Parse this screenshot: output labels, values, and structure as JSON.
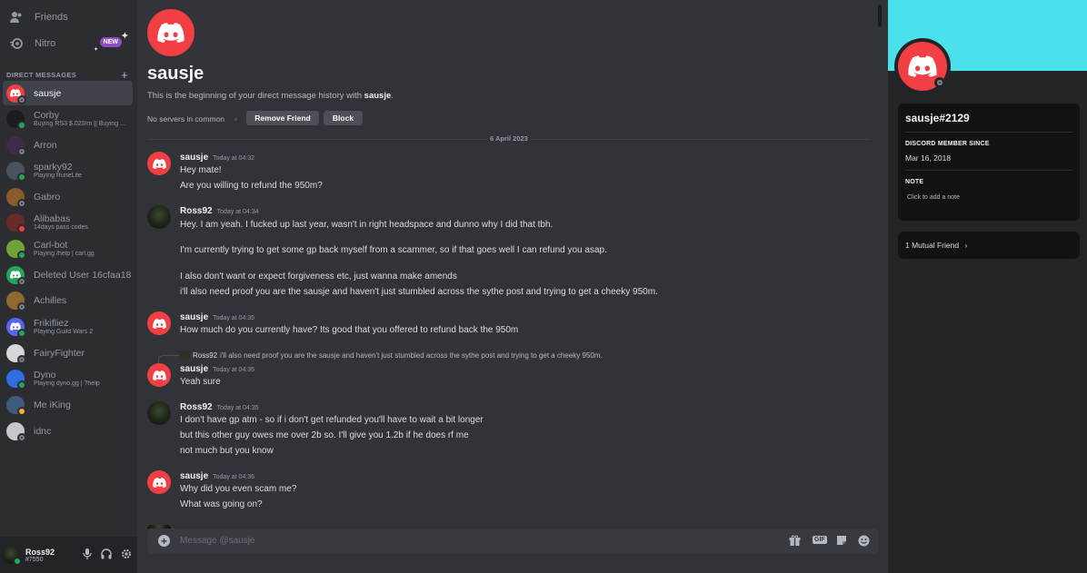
{
  "sidebar": {
    "friends_label": "Friends",
    "nitro_label": "Nitro",
    "nitro_badge": "NEW",
    "dm_header": "DIRECT MESSAGES",
    "dm_add": "+",
    "dms": [
      {
        "name": "sausje",
        "sub": "",
        "status": "offline",
        "avatar": "discord",
        "color": "#f23f43"
      },
      {
        "name": "Corby",
        "sub": "Buying RS3 $.020/m || Buying ...",
        "status": "online",
        "avatar": "image",
        "color": "#1c1c1c"
      },
      {
        "name": "Arron",
        "sub": "",
        "status": "offline",
        "avatar": "image",
        "color": "#3d2d4a"
      },
      {
        "name": "sparky92",
        "sub": "Playing RuneLite",
        "status": "online",
        "avatar": "image",
        "color": "#4a5160"
      },
      {
        "name": "Gabro",
        "sub": "",
        "status": "offline",
        "avatar": "image",
        "color": "#8a5b2b"
      },
      {
        "name": "Alibabas",
        "sub": "14days pass codes",
        "status": "dnd",
        "avatar": "image",
        "color": "#6b2a2a"
      },
      {
        "name": "Carl-bot",
        "sub": "Playing /help | carl.gg",
        "status": "online",
        "avatar": "image",
        "color": "#6fa33c"
      },
      {
        "name": "Deleted User 16cfaa18",
        "sub": "",
        "status": "offline",
        "avatar": "discord",
        "color": "#23a55a"
      },
      {
        "name": "Achilles",
        "sub": "",
        "status": "offline",
        "avatar": "image",
        "color": "#8f6a2e"
      },
      {
        "name": "Frikifliez",
        "sub": "Playing Guild Wars 2",
        "status": "online",
        "avatar": "discord",
        "color": "#5865f2"
      },
      {
        "name": "FairyFighter",
        "sub": "",
        "status": "offline",
        "avatar": "image",
        "color": "#d5d7da"
      },
      {
        "name": "Dyno",
        "sub": "Playing dyno.gg | ?help",
        "status": "online",
        "avatar": "image",
        "color": "#2f6de1"
      },
      {
        "name": "Me iKing",
        "sub": "",
        "status": "idle",
        "avatar": "image",
        "color": "#3f5a7a"
      },
      {
        "name": "idnc",
        "sub": "",
        "status": "offline",
        "avatar": "image",
        "color": "#c9c9c9"
      }
    ]
  },
  "user": {
    "name": "Ross92",
    "tag": "#7550"
  },
  "header": {
    "title": "sausje",
    "intro_prefix": "This is the beginning of your direct message history with ",
    "intro_name": "sausje",
    "intro_suffix": ".",
    "servers": "No servers in common",
    "remove_friend": "Remove Friend",
    "block": "Block"
  },
  "date_divider": "6 April 2023",
  "messages": [
    {
      "author": "sausje",
      "time": "Today at 04:32",
      "lines": [
        "Hey mate!",
        "Are you willing to refund the 950m?"
      ]
    },
    {
      "author": "Ross92",
      "time": "Today at 04:34",
      "lines": [
        "Hey. I am yeah. I fucked up last year, wasn't in right headspace and dunno why I did that tbh.",
        "I'm currently trying to get some gp back myself from a scammer, so if that goes well I can refund you asap.",
        "I also don't want or expect forgiveness etc, just wanna make amends",
        "i'll also need proof you are the sausje and haven't just stumbled across the sythe post and trying to get a cheeky 950m."
      ]
    },
    {
      "author": "sausje",
      "time": "Today at 04:35",
      "lines": [
        "How much do you currently have? Its good that you offered to refund back the 950m"
      ]
    },
    {
      "author": "sausje",
      "time": "Today at 04:35",
      "reply_author": "Ross92",
      "reply_text": "i'll also need proof you are the sausje and haven't just stumbled across the sythe post and trying to get a cheeky 950m.",
      "lines": [
        "Yeah sure"
      ]
    },
    {
      "author": "Ross92",
      "time": "Today at 04:35",
      "lines": [
        "I don't have gp atm - so if i don't get refunded you'll have to wait a bit longer",
        "but this other guy owes me over 2b so. I'll give you 1.2b if he does rf me",
        "not much but you know"
      ]
    },
    {
      "author": "sausje",
      "time": "Today at 04:36",
      "lines": [
        "Why did you even scam me?",
        "What was going on?"
      ]
    }
  ],
  "composer": {
    "placeholder": "Message @sausje",
    "gif": "GIF"
  },
  "profile": {
    "banner_color": "#4be1ec",
    "username": "sausje#2129",
    "member_since_label": "DISCORD MEMBER SINCE",
    "member_since": "Mar 16, 2018",
    "note_label": "NOTE",
    "note_placeholder": "Click to add a note",
    "mutual": "1 Mutual Friend"
  },
  "colors": {
    "accent_red": "#f23f43",
    "online": "#23a55a",
    "nitro": "#8f4cc4"
  }
}
